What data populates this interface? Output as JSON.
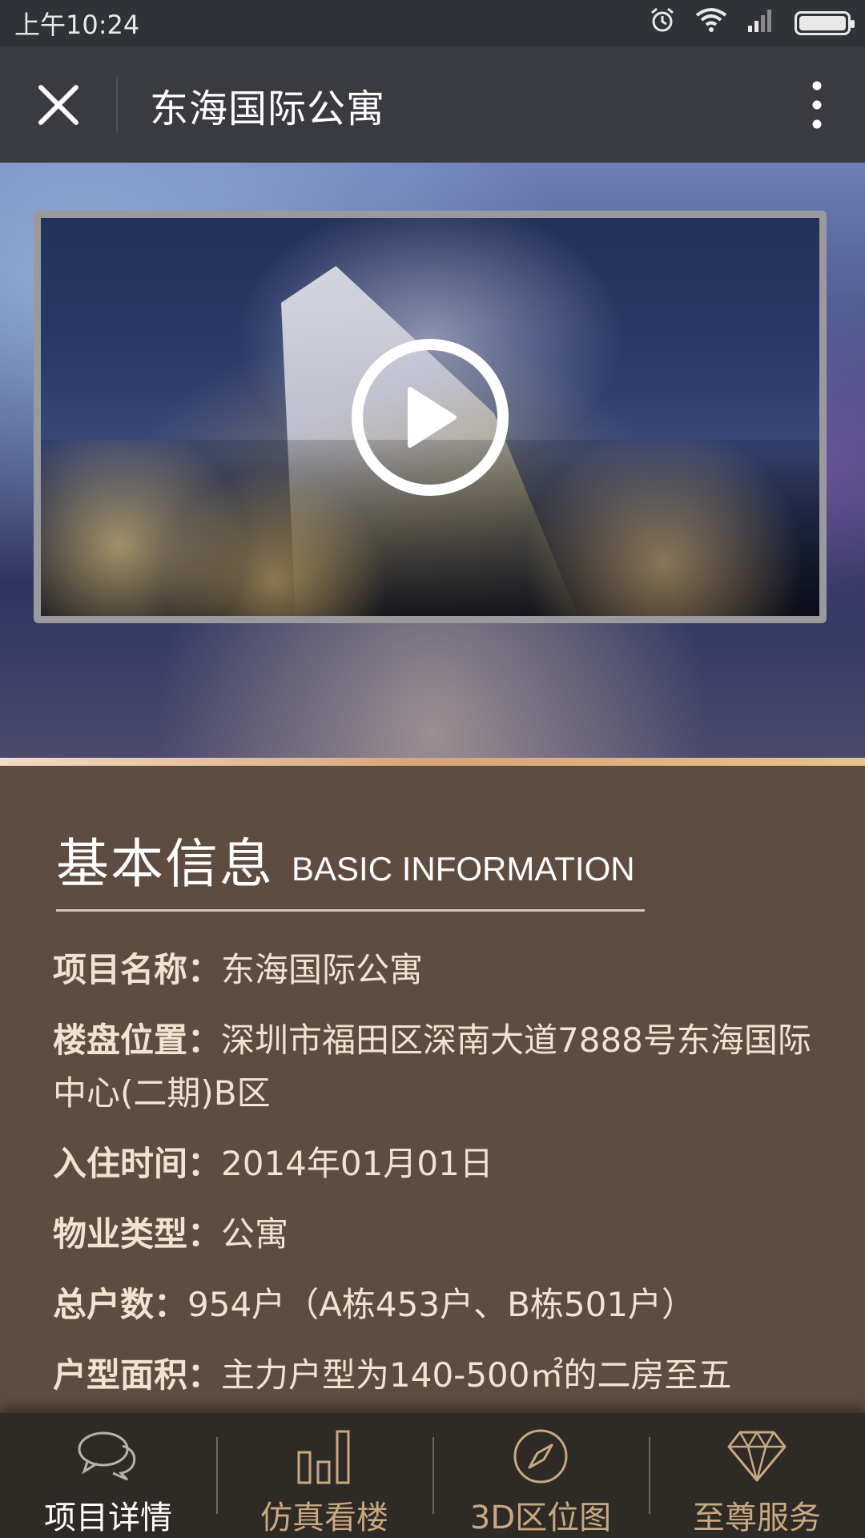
{
  "status_bar": {
    "time": "上午10:24"
  },
  "app_bar": {
    "title": "东海国际公寓",
    "close_icon": "close-icon",
    "more_icon": "more-vertical-icon"
  },
  "hero": {
    "play_icon": "play-icon"
  },
  "info": {
    "section_title_cn": "基本信息",
    "section_title_en": "BASIC INFORMATION",
    "rows": [
      {
        "label": "项目名称：",
        "value": "东海国际公寓"
      },
      {
        "label": "楼盘位置：",
        "value": "深圳市福田区深南大道7888号东海国际中心(二期)B区"
      },
      {
        "label": "入住时间：",
        "value": "2014年01月01日"
      },
      {
        "label": "物业类型：",
        "value": "公寓"
      },
      {
        "label": "总户数：",
        "value": "954户（A栋453户、B栋501户）"
      },
      {
        "label": "户型面积：",
        "value": "主力户型为140-500㎡的二房至五"
      }
    ]
  },
  "bottom_nav": {
    "items": [
      {
        "label": "项目详情",
        "icon": "chat-bubbles-icon",
        "active": true
      },
      {
        "label": "仿真看楼",
        "icon": "bar-chart-icon",
        "active": false
      },
      {
        "label": "3D区位图",
        "icon": "compass-icon",
        "active": false
      },
      {
        "label": "至尊服务",
        "icon": "diamond-icon",
        "active": false
      }
    ]
  },
  "colors": {
    "status_bar_bg": "#2f3236",
    "app_bar_bg": "#393b41",
    "info_bg": "#5f4c41",
    "info_text": "#f0e3cf",
    "nav_bg": "#2e2a26",
    "nav_label": "#c8a881",
    "nav_active_label": "#ffffff"
  }
}
